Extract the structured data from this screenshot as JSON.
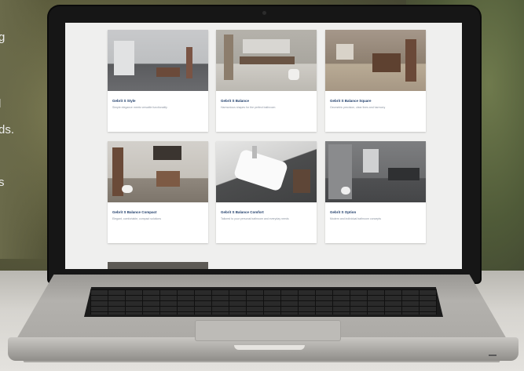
{
  "background_text": [
    {
      "text": "g"
    },
    {
      "text": "l"
    },
    {
      "text": "ds."
    },
    {
      "text": "s"
    }
  ],
  "screen": {
    "cards": [
      {
        "title": "Gebrit S Style",
        "description": "Simple elegance meets versatile functionality"
      },
      {
        "title": "Gebrit S Balance",
        "description": "Harmonious shapes for the perfect bathroom"
      },
      {
        "title": "Gebrit S Balance Square",
        "description": "Geometric precision, clear lines and harmony"
      },
      {
        "title": "Gebrit S Balance Compact",
        "description": "Elegant, comfortable, compact solutions"
      },
      {
        "title": "Gebrit S Balance Comfort",
        "description": "Tailored to your personal bathroom and everyday needs"
      },
      {
        "title": "Gebrit S Option",
        "description": "Modern and individual bathroom concepts"
      }
    ]
  },
  "colors": {
    "card_title": "#1f3d6a",
    "card_description": "#8a93a0",
    "screen_background": "#efefee"
  }
}
